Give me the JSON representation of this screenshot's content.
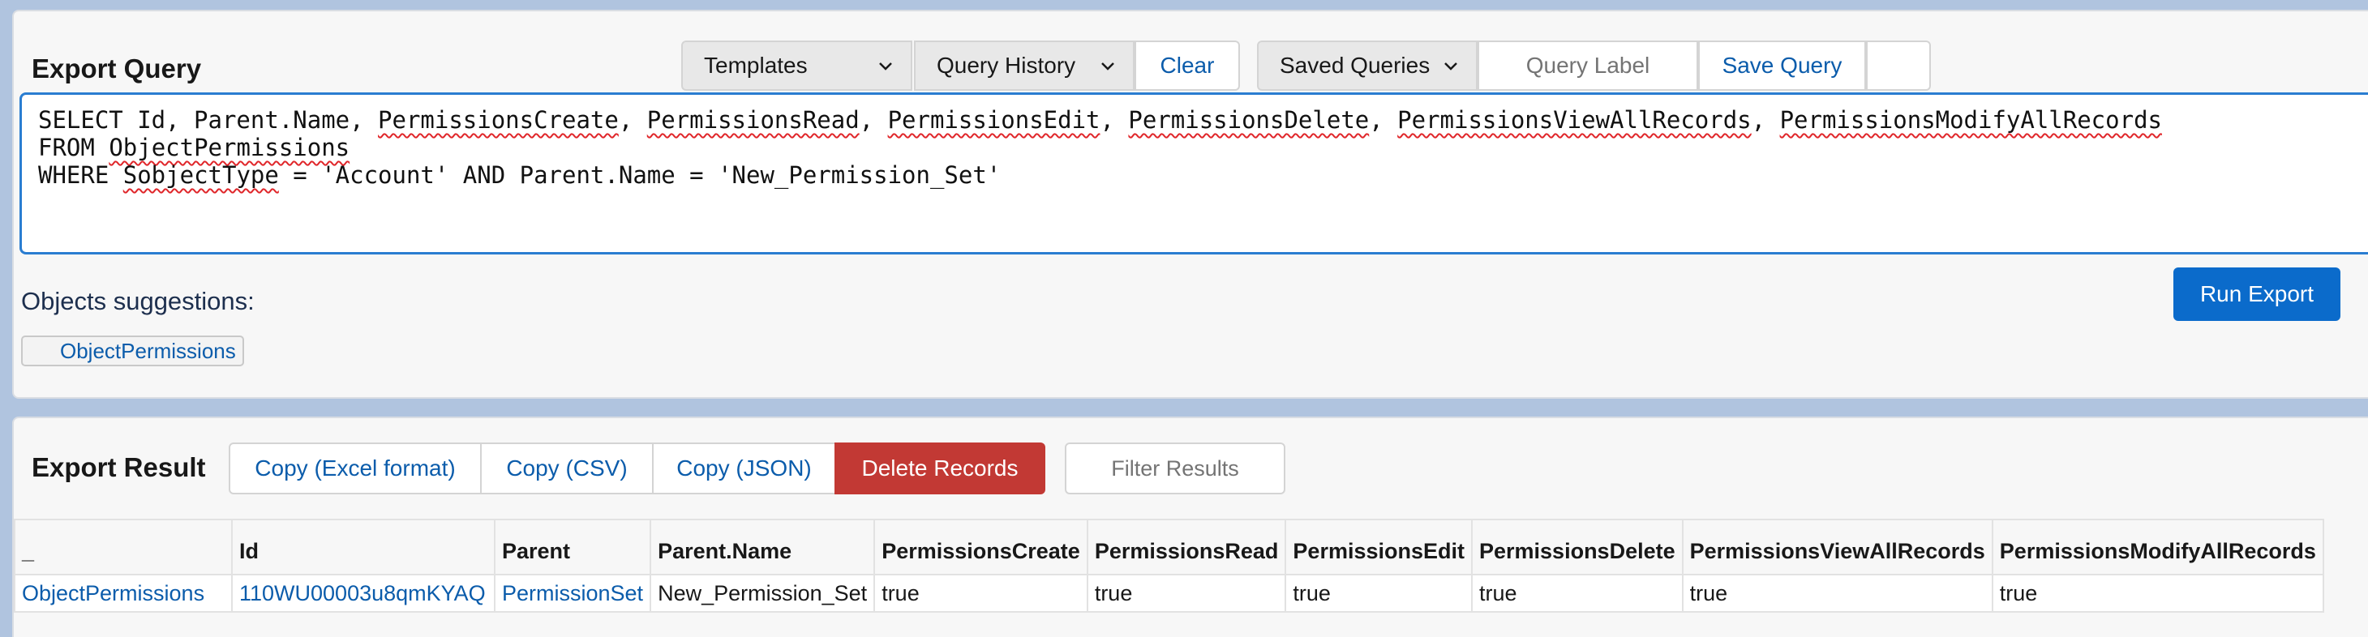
{
  "query_panel": {
    "title": "Export Query",
    "templates_label": "Templates",
    "history_label": "Query History",
    "clear_label": "Clear",
    "saved_label": "Saved Queries",
    "label_placeholder": "Query Label",
    "save_label": "Save Query",
    "query_lines": [
      [
        "SELECT Id, Parent.Name, ",
        {
          "sq": "PermissionsCreate"
        },
        ", ",
        {
          "sq": "PermissionsRead"
        },
        ", ",
        {
          "sq": "PermissionsEdit"
        },
        ", ",
        {
          "sq": "PermissionsDelete"
        },
        ", ",
        {
          "sq": "PermissionsViewAllRecords"
        },
        ", ",
        {
          "sq": "PermissionsModifyAllRecords"
        }
      ],
      [
        "FROM ",
        {
          "sq": "ObjectPermissions"
        }
      ],
      [
        "WHERE ",
        {
          "sq": "SobjectType"
        },
        " = 'Account' AND Parent.Name = 'New_Permission_Set'"
      ]
    ],
    "suggestions_label": "Objects suggestions:",
    "suggestion_item": "ObjectPermissions",
    "run_label": "Run Export"
  },
  "result_panel": {
    "title": "Export Result",
    "copy_excel": "Copy (Excel format)",
    "copy_csv": "Copy (CSV)",
    "copy_json": "Copy (JSON)",
    "delete_label": "Delete Records",
    "filter_placeholder": "Filter Results",
    "columns": [
      "_",
      "Id",
      "Parent",
      "Parent.Name",
      "PermissionsCreate",
      "PermissionsRead",
      "PermissionsEdit",
      "PermissionsDelete",
      "PermissionsViewAllRecords",
      "PermissionsModifyAllRecords"
    ],
    "rows": [
      [
        "ObjectPermissions",
        "110WU00003u8qmKYAQ",
        "PermissionSet",
        "New_Permission_Set",
        "true",
        "true",
        "true",
        "true",
        "true",
        "true"
      ]
    ]
  },
  "colors": {
    "accent": "#0b6bcb",
    "link": "#0b5cab",
    "danger": "#c23934",
    "page_bg": "#b0c4df"
  }
}
